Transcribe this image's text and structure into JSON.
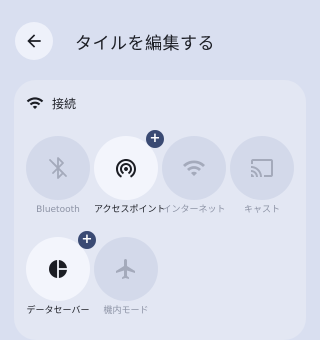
{
  "header": {
    "title": "タイルを編集する",
    "back_icon": "arrow-back-icon"
  },
  "section": {
    "label": "接続",
    "icon": "wifi-icon"
  },
  "tiles": [
    {
      "label": "Bluetooth",
      "icon": "bluetooth-disabled-icon",
      "active": false
    },
    {
      "label": "アクセスポイント",
      "icon": "hotspot-icon",
      "active": true,
      "badge": "+"
    },
    {
      "label": "インターネット",
      "icon": "wifi-icon",
      "active": false
    },
    {
      "label": "キャスト",
      "icon": "cast-icon",
      "active": false
    },
    {
      "label": "データセーバー",
      "icon": "data-saver-icon",
      "active": true,
      "badge": "+"
    },
    {
      "label": "機内モード",
      "icon": "airplane-icon",
      "active": false
    }
  ],
  "colors": {
    "background": "#d9dff0",
    "card": "#e3e7f3",
    "tile_inactive": "#d3d9ea",
    "tile_active": "#f3f5fc",
    "badge": "#3a4a73",
    "icon_inactive": "#a4aabb",
    "text_inactive": "#8e94a6"
  }
}
